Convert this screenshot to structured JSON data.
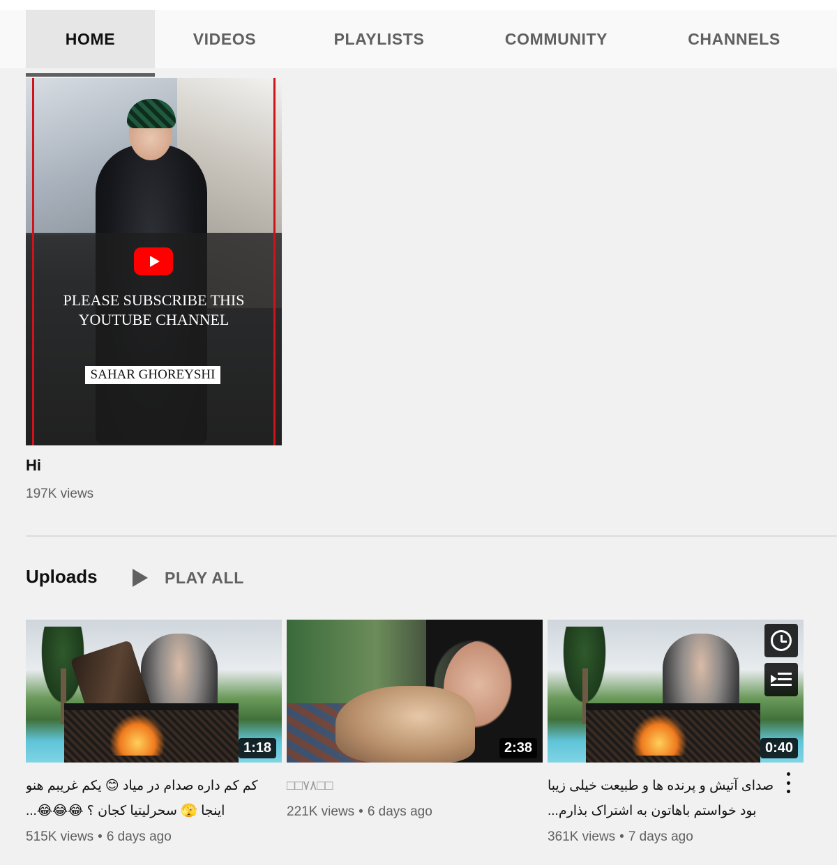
{
  "tabs": [
    {
      "label": "HOME",
      "active": true
    },
    {
      "label": "VIDEOS",
      "active": false
    },
    {
      "label": "PLAYLISTS",
      "active": false
    },
    {
      "label": "COMMUNITY",
      "active": false
    },
    {
      "label": "CHANNELS",
      "active": false
    }
  ],
  "featured": {
    "thumb_text": "PLEASE SUBSCRIBE THIS\nYOUTUBE CHANNEL",
    "thumb_name": "SAHAR GHOREYSHI",
    "title": "Hi",
    "views": "197K views"
  },
  "uploads": {
    "title": "Uploads",
    "play_all": "PLAY ALL",
    "videos": [
      {
        "duration": "1:18",
        "title": "کم کم داره صدام در میاد 😊 یکم غریبم هنو اینجا 🫣 سحرلیتیا کجان ؟ 😂😂😂...",
        "views": "515K views",
        "age": "6 days ago"
      },
      {
        "duration": "2:38",
        "title": "□□۷۸□□",
        "views": "221K views",
        "age": "6 days ago"
      },
      {
        "duration": "0:40",
        "title": "صدای آتیش و پرنده ها و طبیعت خیلی زیبا بود خواستم باهاتون به اشتراک بذارم...",
        "views": "361K views",
        "age": "7 days ago"
      }
    ]
  },
  "icons": {
    "play_all": "play-icon",
    "watch_later": "clock-icon",
    "add_to_queue": "queue-icon",
    "more": "kebab-icon"
  }
}
